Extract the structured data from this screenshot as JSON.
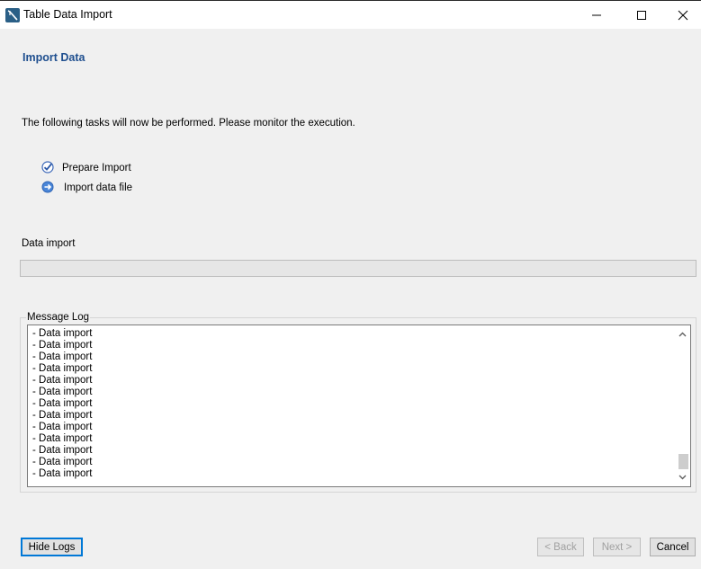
{
  "window": {
    "title": "Table Data Import",
    "icon": "mysql-workbench-icon"
  },
  "page": {
    "heading": "Import Data",
    "intro": "The following tasks will now be performed. Please monitor the execution."
  },
  "tasks": [
    {
      "label": "Prepare Import",
      "status": "done",
      "icon": "checkmark-icon"
    },
    {
      "label": "Import data file",
      "status": "in-progress",
      "icon": "arrow-right-circle-icon"
    }
  ],
  "progress": {
    "label": "Data import",
    "value": 0
  },
  "log": {
    "legend": "Message Log",
    "lines": [
      "- Data import",
      "- Data import",
      "- Data import",
      "- Data import",
      "- Data import",
      "- Data import",
      "- Data import",
      "- Data import",
      "- Data import",
      "- Data import",
      "- Data import",
      "- Data import",
      "- Data import"
    ]
  },
  "buttons": {
    "hide_logs": "Hide Logs",
    "back": "< Back",
    "next": "Next >",
    "cancel": "Cancel"
  },
  "colors": {
    "heading": "#1f4f8f",
    "focus": "#0078d7"
  }
}
